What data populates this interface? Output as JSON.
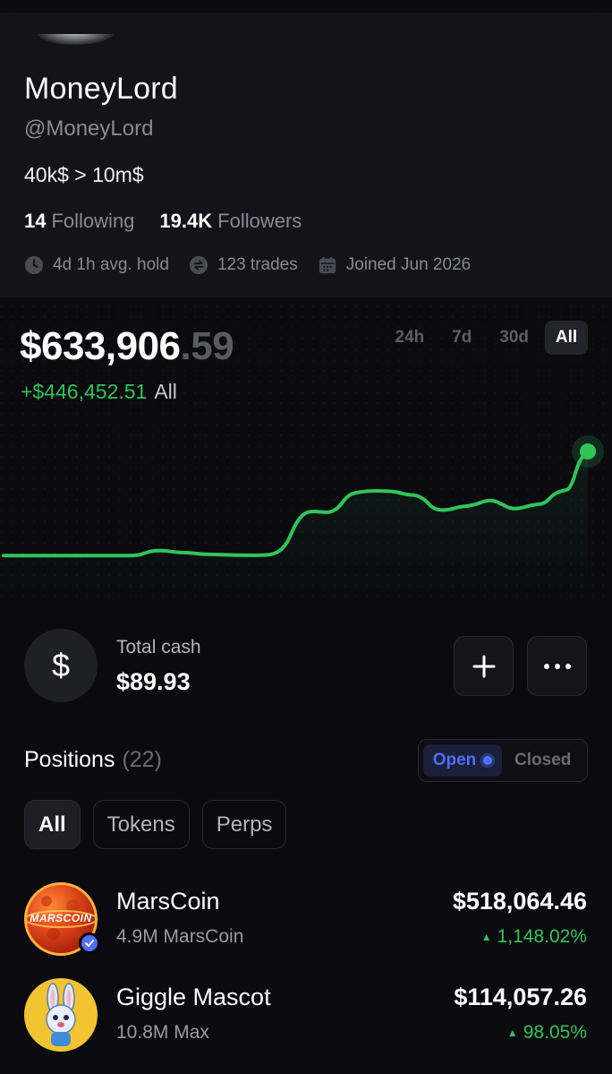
{
  "profile": {
    "name": "MoneyLord",
    "handle": "@MoneyLord",
    "bio": "40k$ > 10m$",
    "following_count": "14",
    "following_label": "Following",
    "followers_count": "19.4K",
    "followers_label": "Followers",
    "avg_hold": "4d 1h avg. hold",
    "trades": "123 trades",
    "joined": "Joined Jun 2026"
  },
  "portfolio": {
    "value_main": "$633,906",
    "value_cents": ".59",
    "pnl": "+$446,452.51",
    "period": "All",
    "ranges": [
      "24h",
      "7d",
      "30d",
      "All"
    ],
    "active_range": "All",
    "colors": {
      "positive": "#2fc559",
      "accent": "#4f6ff5"
    }
  },
  "chart_data": {
    "type": "line",
    "series": [
      {
        "values": [
          2,
          2,
          2,
          2,
          2,
          2,
          2,
          2,
          2,
          2,
          2,
          2,
          2,
          2,
          2,
          2,
          2.5,
          4.5,
          5,
          4.7,
          4,
          3.7,
          3.5,
          2.8,
          2.7,
          2.5,
          2.4,
          2.2,
          2.2,
          2.1,
          2.2,
          2.4,
          4,
          9,
          21,
          27,
          28,
          27.5,
          27.2,
          30,
          37,
          39,
          39.5,
          40,
          39.8,
          39.7,
          39,
          37.5,
          37.5,
          35,
          29.5,
          28.5,
          29,
          30.5,
          31,
          32,
          34,
          34.5,
          32,
          29.5,
          29.5,
          31,
          32,
          32.5,
          38,
          40,
          41,
          58,
          63
        ]
      }
    ]
  },
  "cash": {
    "label": "Total cash",
    "value": "$89.93",
    "icon": "dollar-icon"
  },
  "positions": {
    "title": "Positions",
    "count": "(22)",
    "toggle": {
      "open": "Open",
      "closed": "Closed",
      "active": "Open"
    },
    "filters": [
      "All",
      "Tokens",
      "Perps"
    ],
    "active_filter": "All",
    "items": [
      {
        "name": "MarsCoin",
        "qty": "4.9M MarsCoin",
        "value": "$518,064.46",
        "change": "1,148.02%",
        "logo_text": "MARSCOIN",
        "verified": true
      },
      {
        "name": "Giggle Mascot",
        "qty": "10.8M Max",
        "value": "$114,057.26",
        "change": "98.05%",
        "verified": false
      }
    ]
  }
}
